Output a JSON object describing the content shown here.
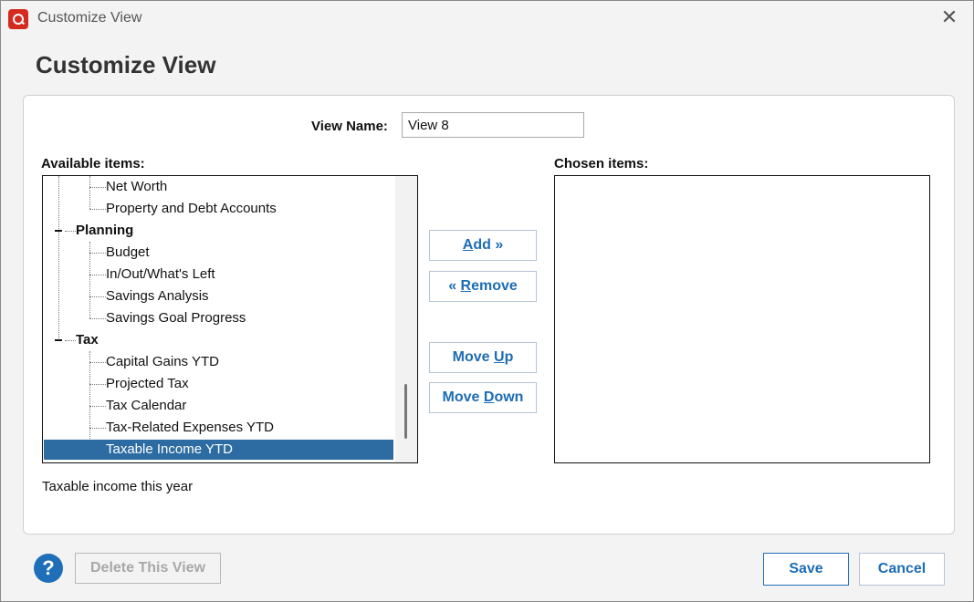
{
  "window": {
    "title": "Customize View",
    "close_symbol": "✕"
  },
  "page": {
    "title": "Customize View"
  },
  "view_name": {
    "label": "View Name:",
    "value": "View 8"
  },
  "available": {
    "label": "Available items:",
    "items": [
      {
        "label": "Net Worth",
        "type": "child"
      },
      {
        "label": "Property and Debt Accounts",
        "type": "child"
      },
      {
        "label": "Planning",
        "type": "group"
      },
      {
        "label": "Budget",
        "type": "child"
      },
      {
        "label": "In/Out/What's Left",
        "type": "child"
      },
      {
        "label": "Savings Analysis",
        "type": "child"
      },
      {
        "label": "Savings Goal Progress",
        "type": "child"
      },
      {
        "label": "Tax",
        "type": "group"
      },
      {
        "label": "Capital Gains YTD",
        "type": "child"
      },
      {
        "label": "Projected Tax",
        "type": "child"
      },
      {
        "label": "Tax Calendar",
        "type": "child"
      },
      {
        "label": "Tax-Related Expenses YTD",
        "type": "child"
      },
      {
        "label": "Taxable Income YTD",
        "type": "child",
        "selected": true
      }
    ]
  },
  "chosen": {
    "label": "Chosen items:",
    "items": []
  },
  "buttons": {
    "add": {
      "pre": "",
      "ul": "A",
      "post": "dd »"
    },
    "remove": {
      "pre": "« ",
      "ul": "R",
      "post": "emove"
    },
    "move_up": {
      "pre": "Move ",
      "ul": "U",
      "post": "p"
    },
    "move_down": {
      "pre": "Move ",
      "ul": "D",
      "post": "own"
    },
    "delete_view": "Delete This View",
    "save": "Save",
    "cancel": "Cancel",
    "help": "?"
  },
  "description": "Taxable income this year",
  "colors": {
    "accent": "#1d6db5",
    "selection": "#2d6ca2",
    "brand": "#d52b1e"
  }
}
